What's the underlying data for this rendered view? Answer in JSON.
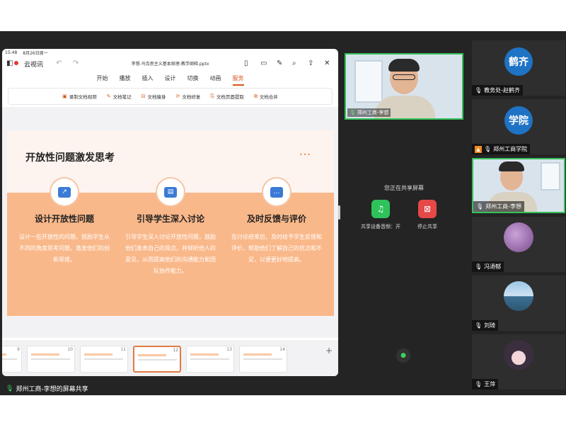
{
  "status_bar": {
    "time": "15:48",
    "date": "8月26日周一",
    "dots": "•••"
  },
  "tablet": {
    "recording_label": "云视讯",
    "file_name": "李想-马克思主义基本原理-教学阐释.pptx",
    "menu": [
      "开始",
      "播放",
      "插入",
      "设计",
      "切换",
      "动画",
      "服务"
    ],
    "active_menu": "服务",
    "ribbon": [
      {
        "icon": "video-icon",
        "label": "录制文档视频"
      },
      {
        "icon": "note-icon",
        "label": "文档笔记"
      },
      {
        "icon": "slim-icon",
        "label": "文档瘦身"
      },
      {
        "icon": "repair-icon",
        "label": "文档修复"
      },
      {
        "icon": "extract-icon",
        "label": "文档页面提取"
      },
      {
        "icon": "merge-icon",
        "label": "文档合并"
      }
    ],
    "slide": {
      "title": "开放性问题激发思考",
      "columns": [
        {
          "heading": "设计开放性问题",
          "body": "设计一些开放性的问题，鼓励学生从不同的角度思考问题，激发他们的创新思维。"
        },
        {
          "heading": "引导学生深入讨论",
          "body": "引导学生深入讨论开放性问题，鼓励他们发表自己的观点，并倾听他人的意见，从而提高他们的沟通能力和团队协作能力。"
        },
        {
          "heading": "及时反馈与评价",
          "body": "在讨论结束后，及时给予学生反馈和评价，帮助他们了解自己的优点和不足，以便更好地提高。"
        }
      ]
    },
    "thumbnails": [
      "9",
      "10",
      "11",
      "12",
      "13",
      "14"
    ],
    "selected_thumbnail": "12"
  },
  "meeting": {
    "presenter_name": "郑州工商-李想",
    "sharing_text": "您正在共享屏幕",
    "share_audio_label": "共享设备音频：开",
    "stop_share_label": "停止共享",
    "bottom_label": "郑州工商-李想的屏幕共享",
    "participants": [
      {
        "avatar_text": "鹤齐",
        "name": "教务处-赵鹤齐",
        "avatar_color": "#1f73c5"
      },
      {
        "avatar_text": "学院",
        "name": "郑州工商学院",
        "avatar_color": "#1f73c5"
      },
      {
        "avatar_text": "",
        "name": "郑州工商-李想"
      },
      {
        "avatar_text": "",
        "name": "冯迺郁"
      },
      {
        "avatar_text": "",
        "name": "刘琦"
      },
      {
        "avatar_text": "",
        "name": "王萍"
      }
    ]
  },
  "colors": {
    "accent": "#d9541c",
    "active_border": "#36c15a",
    "slide_band": "#f9b88a"
  }
}
